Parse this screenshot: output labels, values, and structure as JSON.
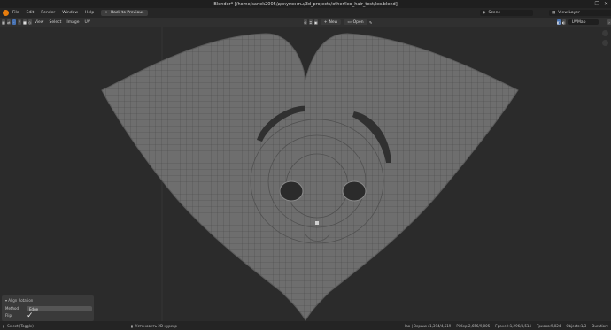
{
  "window": {
    "title": "Blender* [/home/sanek2005/документы/3d_projects/other/leo_hair_test/leo.blend]",
    "controls": [
      "–",
      "❐",
      "✕"
    ]
  },
  "topbar": {
    "menus": [
      "File",
      "Edit",
      "Render",
      "Window",
      "Help"
    ],
    "back_button": "Back to Previous",
    "scene_label": "Scene",
    "view_layer_label": "View Layer"
  },
  "toolbar": {
    "menus": [
      "View",
      "Select",
      "Image",
      "UV"
    ],
    "new_button": "New",
    "open_button": "Open",
    "uvmap_label": "UVMap"
  },
  "operator_panel": {
    "title": "Align Rotation",
    "method_label": "Method",
    "method_value": "Edge",
    "flip_label": "Flip"
  },
  "statusbar": {
    "left": "Select (Toggle)",
    "middle": "Установить 2D-курсор",
    "right": [
      "Iao | Вершин:1,394/4,519",
      "Рёбер:2,656/9,005",
      "Граней:1,296/4,514",
      "Трисов:9,024",
      "Objects:1/3",
      "Duration:"
    ]
  },
  "colors": {
    "accent": "#4772b3",
    "mesh_fill": "#6e6e6e",
    "mesh_wire": "#464646",
    "background": "#2b2b2b"
  }
}
